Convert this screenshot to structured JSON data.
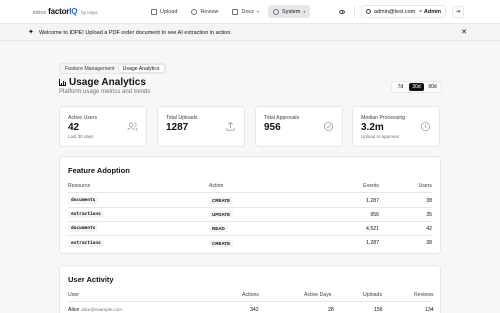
{
  "brand": {
    "inbox": "inbox",
    "name": "factor",
    "iq": "IQ",
    "by": "by iosys"
  },
  "nav": [
    {
      "label": "Upload",
      "icon": "upload-doc-icon"
    },
    {
      "label": "Review",
      "icon": "eye-icon"
    },
    {
      "label": "Docs",
      "icon": "book-icon",
      "has_caret": true
    },
    {
      "label": "System",
      "icon": "gear-icon",
      "has_caret": true,
      "active": true
    }
  ],
  "user": {
    "email": "admin@test.com",
    "role": "Admin"
  },
  "banner": {
    "text": "Welcome to IDPE! Upload a PDF order document to see AI extraction in action."
  },
  "tabs": [
    {
      "label": "Feature Management",
      "active": false
    },
    {
      "label": "Usage Analytics",
      "active": true
    }
  ],
  "page": {
    "title": "Usage Analytics",
    "subtitle": "Platform usage metrics and trends"
  },
  "range": [
    {
      "label": "7d",
      "active": false
    },
    {
      "label": "30d",
      "active": true
    },
    {
      "label": "90d",
      "active": false
    }
  ],
  "stats": [
    {
      "label": "Active Users",
      "value": "42",
      "sub": "Last 30 days",
      "icon": "users-icon"
    },
    {
      "label": "Total Uploads",
      "value": "1287",
      "sub": "",
      "icon": "upload-icon"
    },
    {
      "label": "Total Approvals",
      "value": "956",
      "sub": "",
      "icon": "check-circle-icon"
    },
    {
      "label": "Median Processing",
      "value": "3.2m",
      "sub": "Upload to approval",
      "icon": "clock-icon"
    }
  ],
  "adoption": {
    "title": "Feature Adoption",
    "columns": [
      "Resource",
      "Action",
      "Events",
      "Users"
    ],
    "rows": [
      {
        "resource": "documents",
        "action": "CREATE",
        "events": "1,287",
        "users": "38"
      },
      {
        "resource": "extractions",
        "action": "UPDATE",
        "events": "956",
        "users": "35"
      },
      {
        "resource": "documents",
        "action": "READ",
        "events": "4,521",
        "users": "42"
      },
      {
        "resource": "extractions",
        "action": "CREATE",
        "events": "1,287",
        "users": "38"
      }
    ]
  },
  "activity": {
    "title": "User Activity",
    "columns": [
      "User",
      "Actions",
      "Active Days",
      "Uploads",
      "Reviews"
    ],
    "rows": [
      {
        "name": "Alice",
        "email": "alice@example.com",
        "actions": "342",
        "active_days": "28",
        "uploads": "156",
        "reviews": "134"
      }
    ]
  }
}
